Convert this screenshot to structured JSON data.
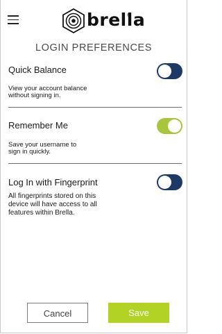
{
  "brand": {
    "name": "brella",
    "trademark": "®"
  },
  "header": {
    "menu_icon": "hamburger-menu-icon",
    "logo_icon": "brella-shield-logo-icon"
  },
  "page": {
    "title": "LOGIN PREFERENCES"
  },
  "settings": [
    {
      "title": "Quick Balance",
      "description_lines": [
        "View your account balance",
        "without signing in."
      ],
      "enabled": false
    },
    {
      "title": "Remember Me",
      "description_lines": [
        "Save your username to",
        "sign in quickly."
      ],
      "enabled": true
    },
    {
      "title": "Log In with Fingerprint",
      "description_lines": [
        "All fingerprints stored on this",
        "device will have access to all",
        "features within Brella."
      ],
      "enabled": false
    }
  ],
  "actions": {
    "cancel_label": "Cancel",
    "save_label": "Save"
  },
  "colors": {
    "toggle_off": "#1d3a67",
    "toggle_on": "#a7c53d",
    "save_button": "#b2d325",
    "divider": "#6e6e6e"
  }
}
